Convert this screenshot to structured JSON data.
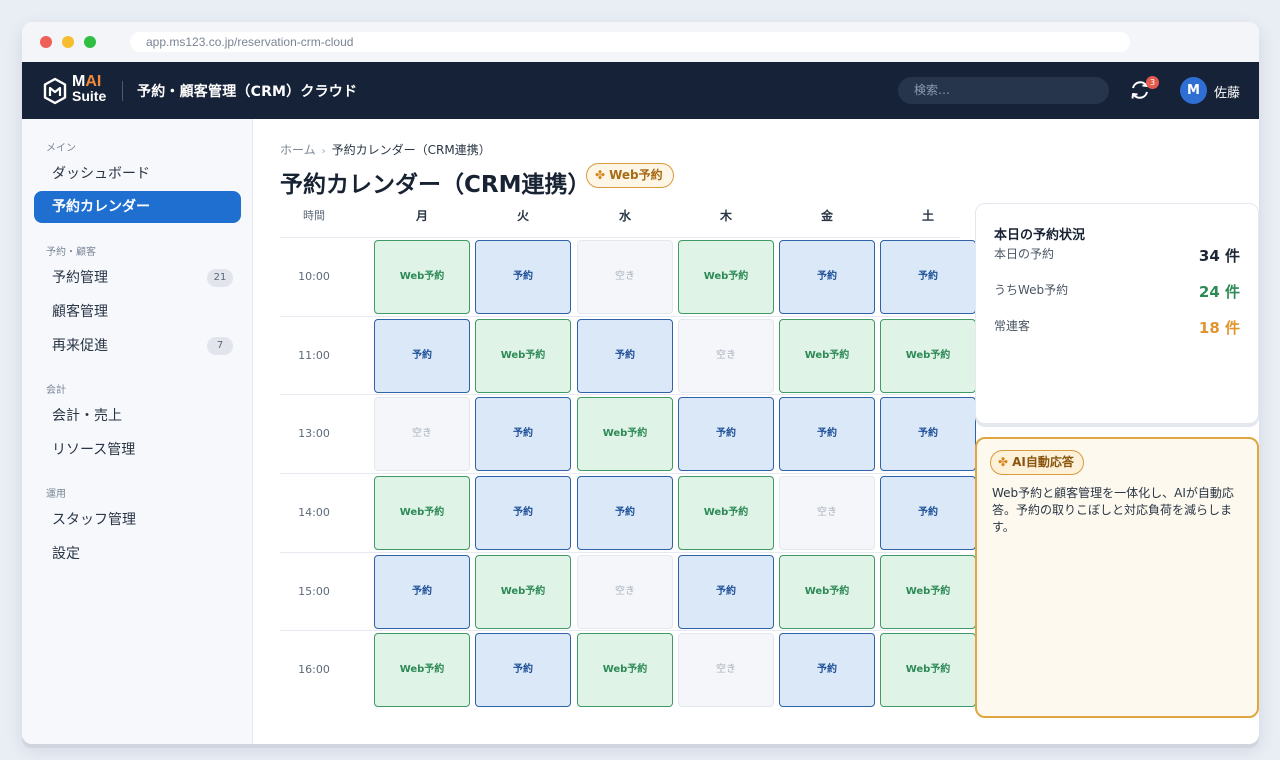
{
  "browser": {
    "url": "app.ms123.co.jp/reservation-crm-cloud"
  },
  "topbar": {
    "logo_line1_prefix": "M",
    "logo_line1_ai": "AI",
    "logo_line2": "Suite",
    "app_title": "予約・顧客管理（CRM）クラウド",
    "search_placeholder": "検索…",
    "notification_count": "3",
    "avatar_initial": "M",
    "user_name": "佐藤"
  },
  "sidebar": {
    "sections": [
      "メイン",
      "予約・顧客",
      "会計",
      "運用"
    ],
    "items": [
      {
        "label": "ダッシュボード"
      },
      {
        "label": "予約カレンダー",
        "active": true
      },
      {
        "label": "予約管理",
        "count": "21"
      },
      {
        "label": "顧客管理"
      },
      {
        "label": "再来促進",
        "count": "7"
      },
      {
        "label": "会計・売上"
      },
      {
        "label": "リソース管理"
      },
      {
        "label": "スタッフ管理"
      },
      {
        "label": "設定"
      }
    ]
  },
  "breadcrumb": {
    "home": "ホーム",
    "current": "予約カレンダー（CRM連携）"
  },
  "page": {
    "title": "予約カレンダー（CRM連携）",
    "badge": "Web予約"
  },
  "calendar": {
    "time_header": "時間",
    "days": [
      "月",
      "火",
      "水",
      "木",
      "金",
      "土"
    ],
    "times": [
      "10:00",
      "11:00",
      "13:00",
      "14:00",
      "15:00",
      "16:00"
    ],
    "status_labels": {
      "web": "Web予約",
      "res": "予約",
      "free": "空き"
    },
    "grid": [
      [
        "web",
        "res",
        "free",
        "web",
        "res",
        "res"
      ],
      [
        "res",
        "web",
        "res",
        "free",
        "web",
        "web"
      ],
      [
        "free",
        "res",
        "web",
        "res",
        "res",
        "res"
      ],
      [
        "web",
        "res",
        "res",
        "web",
        "free",
        "res"
      ],
      [
        "res",
        "web",
        "free",
        "res",
        "web",
        "web"
      ],
      [
        "web",
        "res",
        "web",
        "free",
        "res",
        "web"
      ]
    ]
  },
  "stats": {
    "title": "本日の予約状況",
    "rows": [
      {
        "label": "本日の予約",
        "value": "34 件",
        "color": "#1c2733"
      },
      {
        "label": "うちWeb予約",
        "value": "24 件",
        "color": "#2d8a56"
      },
      {
        "label": "常連客",
        "value": "18 件",
        "color": "#e0952f"
      }
    ]
  },
  "ai_panel": {
    "badge": "AI自動応答",
    "text": "Web予約と顧客管理を一体化し、AIが自動応答。予約の取りこぼしと対応負荷を減らします。"
  },
  "colors": {
    "topbar": "#152238",
    "accent": "#1f6fd1",
    "web": "#2d8a56",
    "reserve": "#1d4f97",
    "warning": "#e0952f"
  }
}
